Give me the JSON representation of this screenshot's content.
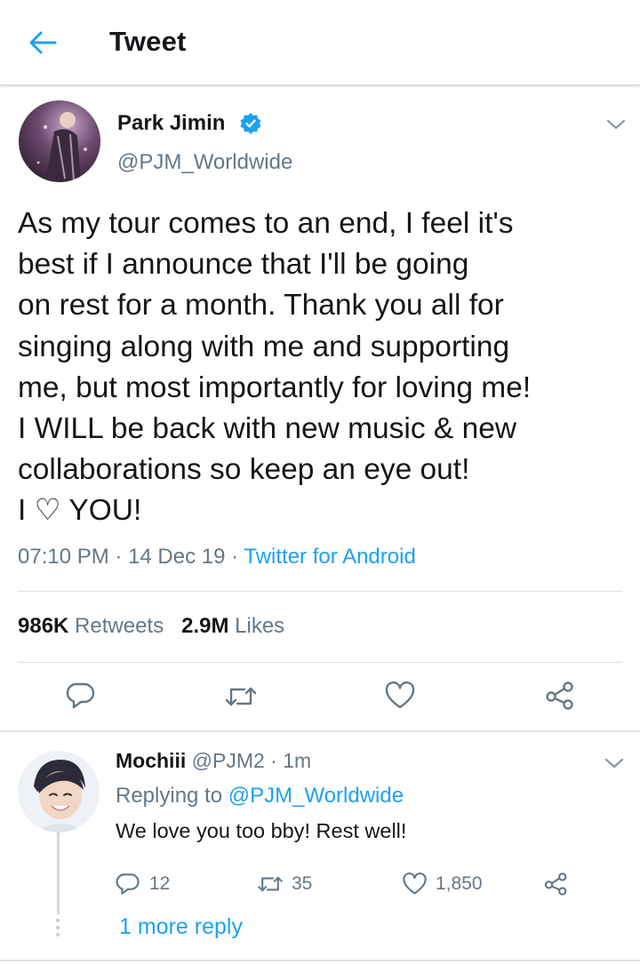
{
  "header": {
    "title": "Tweet",
    "back_icon": "arrow-left-icon"
  },
  "tweet": {
    "author_name": "Park Jimin",
    "author_handle": "@PJM_Worldwide",
    "verified_icon": "verified-badge-icon",
    "text": "As my tour comes to an end, I feel it's\nbest if I announce that I'll be going\non rest for a month. Thank you all for\nsinging along with me and supporting\nme, but most importantly for loving me!\nI WILL be back with new music & new\ncollaborations so keep an eye out!\nI ♡ YOU!",
    "time": "07:10 PM",
    "date": "14 Dec 19",
    "separator": " · ",
    "source": "Twitter for Android",
    "retweets_count": "986K",
    "retweets_label": "Retweets",
    "likes_count": "2.9M",
    "likes_label": "Likes",
    "actions": [
      "reply-icon",
      "retweet-icon",
      "like-icon",
      "share-icon"
    ]
  },
  "reply": {
    "name": "Mochiii",
    "handle": "@PJM2",
    "time": "1m",
    "replying_prefix": "Replying to",
    "replying_to": "@PJM_Worldwide",
    "text": "We love you too bby! Rest well!",
    "reply_count": "12",
    "retweet_count": "35",
    "like_count": "1,850",
    "more_replies": "1 more reply"
  },
  "colors": {
    "accent": "#1da1f2",
    "text_primary": "#14171a",
    "text_secondary": "#657786",
    "divider": "#dcdfe2"
  }
}
